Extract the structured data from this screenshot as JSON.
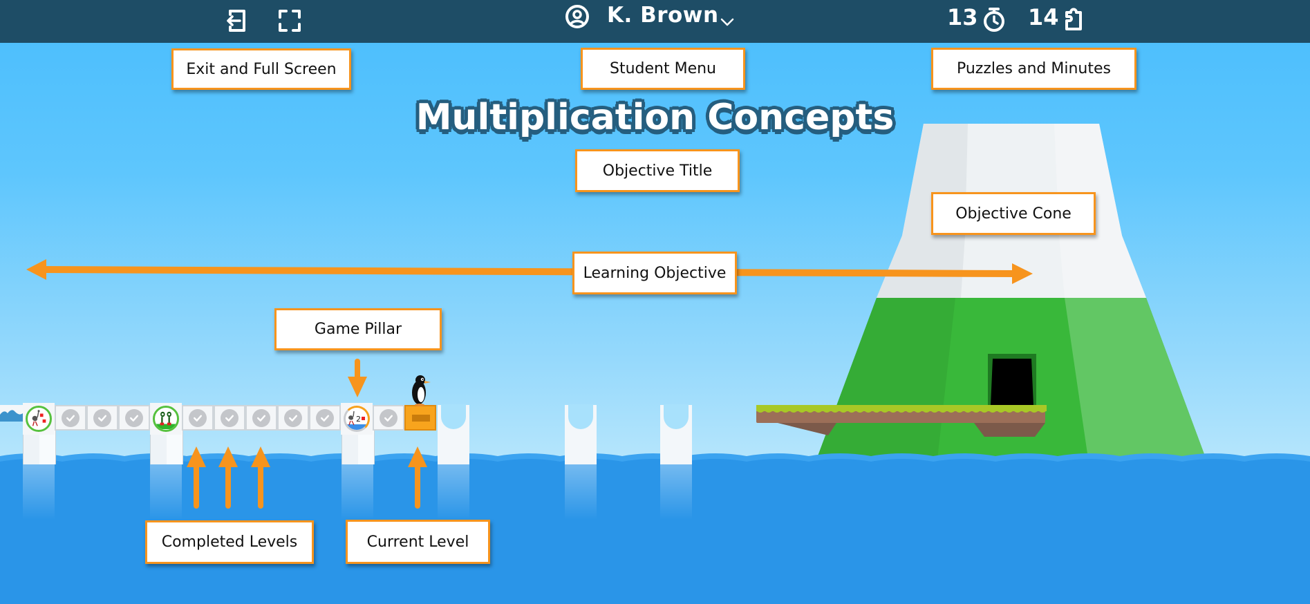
{
  "topbar": {
    "exit_icon": "exit-icon",
    "fullscreen_icon": "fullscreen-icon",
    "user_icon": "user-circle-icon",
    "user_name": "K. Brown",
    "user_menu_icon": "chevron-down-icon",
    "minutes_value": "13",
    "minutes_icon": "stopwatch-icon",
    "puzzles_value": "14",
    "puzzles_icon": "puzzle-piece-icon",
    "background_color": "#1e4d66"
  },
  "objective": {
    "title": "Multiplication Concepts"
  },
  "callouts": {
    "exit_fullscreen": "Exit and Full Screen",
    "student_menu": "Student  Menu",
    "puzzles_minutes": "Puzzles and Minutes",
    "objective_title": "Objective Title",
    "objective_cone": "Objective Cone",
    "learning_objective": "Learning Objective",
    "game_pillar": "Game Pillar",
    "completed_levels": "Completed Levels",
    "current_level": "Current Level"
  },
  "level_path": {
    "levels": [
      {
        "type": "game-pillar",
        "status": "completed",
        "icon": "ostrich-boots-icon"
      },
      {
        "type": "level",
        "status": "completed"
      },
      {
        "type": "level",
        "status": "completed"
      },
      {
        "type": "level",
        "status": "completed"
      },
      {
        "type": "game-pillar",
        "status": "completed",
        "icon": "frog-boots-icon"
      },
      {
        "type": "level",
        "status": "completed"
      },
      {
        "type": "level",
        "status": "completed"
      },
      {
        "type": "level",
        "status": "completed"
      },
      {
        "type": "level",
        "status": "completed"
      },
      {
        "type": "level",
        "status": "completed"
      },
      {
        "type": "game-pillar",
        "status": "in-progress",
        "icon": "ostrich-boots-2-icon",
        "label": "2"
      },
      {
        "type": "level",
        "status": "completed"
      },
      {
        "type": "level",
        "status": "current"
      }
    ],
    "player_icon": "penguin-icon"
  },
  "colors": {
    "accent": "#f7941d",
    "completed_ring": "#56c13e",
    "current_block": "#f8a41d",
    "sea": "#2a95e8",
    "cone_green": "#39b83a"
  }
}
